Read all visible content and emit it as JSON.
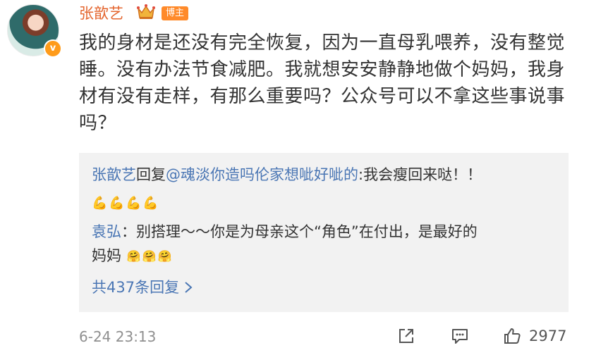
{
  "author": {
    "name": "张歆艺",
    "badge": "博主",
    "verified_mark": "v",
    "crown_icon": "crown-icon"
  },
  "post": {
    "text": "我的身材是还没有完全恢复，因为一直母乳喂养，没有整觉睡。没有办法节食减肥。我就想安安静静地做个妈妈，我身材有没有走样，有那么重要吗？公众号可以不拿这些事说事吗？"
  },
  "replies": [
    {
      "author": "张歆艺",
      "action": "回复",
      "target": "@魂淡你造吗伦家想呲好呲的",
      "text": ":我会瘦回来哒！！",
      "emojis": [
        "💪",
        "💪",
        "💪",
        "💪"
      ]
    },
    {
      "author": "袁弘",
      "separator": "：",
      "text_line1": "别搭理～～你是为母亲这个“角色”在付出，是最好的",
      "text_line2": "妈妈",
      "emojis": [
        "🤗",
        "🤗",
        "🤗"
      ]
    }
  ],
  "more_replies": "共437条回复",
  "footer": {
    "timestamp": "6-24 23:13",
    "like_count": "2977"
  },
  "colors": {
    "username": "#e4662f",
    "link": "#4a76b4",
    "badge_bg": "#ff8a2a",
    "reply_bg": "#f2f2f2",
    "muted": "#8f8f8f"
  }
}
